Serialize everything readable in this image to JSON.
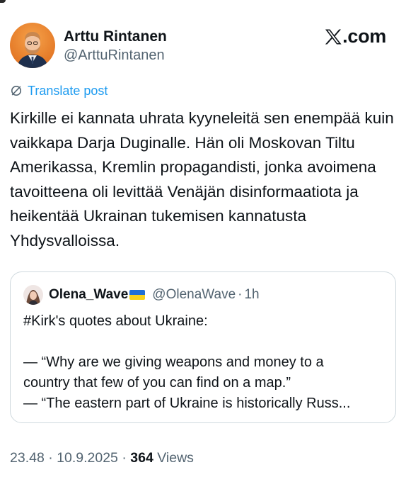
{
  "author": {
    "name": "Arttu Rintanen",
    "handle": "@ArttuRintanen"
  },
  "brand": {
    "label": ".com"
  },
  "translate": {
    "label": "Translate post",
    "color": "#1d9bf0"
  },
  "post": {
    "text": "Kirkille ei kannata uhrata kyyneleitä sen enempää kuin vaikkapa Darja Duginalle. Hän oli Moskovan Tiltu Amerikassa, Kremlin propagandisti, jonka avoimena tavoitteena oli levittää Venäjän disinformaatiota ja heikentää Ukrainan tukemisen kannatusta Yhdysvalloissa."
  },
  "quote": {
    "name": "Olena_Wave",
    "flag": "ukraine-flag",
    "handle": "@OlenaWave",
    "separator": "·",
    "time": "1h",
    "lines": [
      "#Kirk's quotes about Ukraine:",
      "— “Why are we giving weapons and money to a",
      "country that few of you can find on a map.”",
      "— “The eastern part of Ukraine is historically Russ..."
    ]
  },
  "footer": {
    "time": "23.48",
    "sep1": "·",
    "date": "10.9.2025",
    "sep2": "·",
    "views_count": "364",
    "views_label": "Views"
  }
}
